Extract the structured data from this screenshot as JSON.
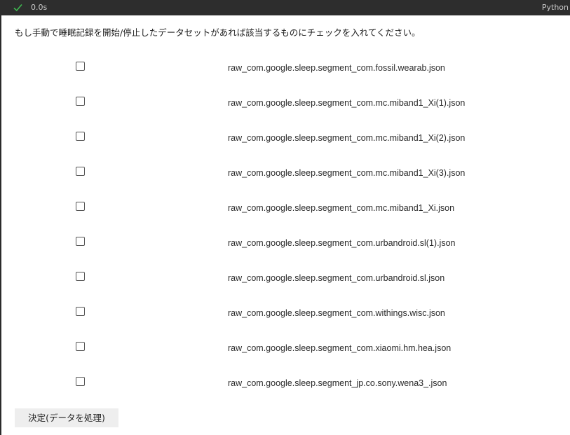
{
  "status_bar": {
    "elapsed_time": "0.0s",
    "kernel_label": "Python",
    "status_icon": "check-icon",
    "status_color": "#3fb950"
  },
  "widget": {
    "instruction": "もし手動で睡眠記録を開始/停止したデータセットがあれば該当するものにチェックを入れてください。",
    "files": [
      {
        "label": "raw_com.google.sleep.segment_com.fossil.wearab.json",
        "checked": false
      },
      {
        "label": "raw_com.google.sleep.segment_com.mc.miband1_Xi(1).json",
        "checked": false
      },
      {
        "label": "raw_com.google.sleep.segment_com.mc.miband1_Xi(2).json",
        "checked": false
      },
      {
        "label": "raw_com.google.sleep.segment_com.mc.miband1_Xi(3).json",
        "checked": false
      },
      {
        "label": "raw_com.google.sleep.segment_com.mc.miband1_Xi.json",
        "checked": false
      },
      {
        "label": "raw_com.google.sleep.segment_com.urbandroid.sl(1).json",
        "checked": false
      },
      {
        "label": "raw_com.google.sleep.segment_com.urbandroid.sl.json",
        "checked": false
      },
      {
        "label": "raw_com.google.sleep.segment_com.withings.wisc.json",
        "checked": false
      },
      {
        "label": "raw_com.google.sleep.segment_com.xiaomi.hm.hea.json",
        "checked": false
      },
      {
        "label": "raw_com.google.sleep.segment_jp.co.sony.wena3_.json",
        "checked": false
      }
    ],
    "submit_label": "決定(データを処理)"
  }
}
